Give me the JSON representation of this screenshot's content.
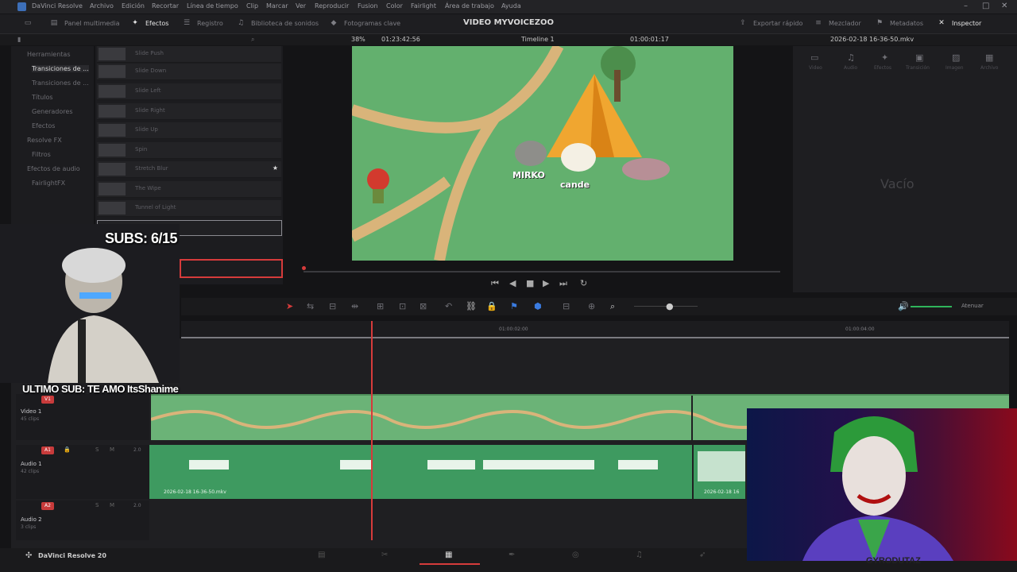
{
  "window": {
    "app_title": "DaVinci Resolve"
  },
  "menu": [
    "Archivo",
    "Edición",
    "Recortar",
    "Línea de tiempo",
    "Clip",
    "Marcar",
    "Ver",
    "Reproducir",
    "Fusion",
    "Color",
    "Fairlight",
    "Área de trabajo",
    "Ayuda"
  ],
  "toolbar": {
    "panel_multimedia": "Panel multimedia",
    "efectos": "Efectos",
    "registro": "Registro",
    "biblioteca": "Biblioteca de sonidos",
    "fotogramas": "Fotogramas clave",
    "project_title": "VIDEO MYVOICEZOO",
    "exportar": "Exportar rápido",
    "mezclador": "Mezclador",
    "metadatos": "Metadatos",
    "inspector": "Inspector"
  },
  "viewer_bar": {
    "zoom": "38%",
    "source_timecode": "01:23:42:56",
    "timeline_name": "Timeline 1",
    "record_timecode": "01:00:01:17",
    "clip_name": "2026-02-18 16-36-50.mkv"
  },
  "left_tree": {
    "herramientas": "Herramientas",
    "transiciones_video": "Transiciones de ...",
    "transiciones_audio": "Transiciones de ...",
    "titulos": "Títulos",
    "generadores": "Generadores",
    "efectos": "Efectos",
    "resolve_fx": "Resolve FX",
    "filtros": "Filtros",
    "efectos_audio": "Efectos de audio",
    "fairlight_fx": "FairlightFX"
  },
  "fx_items": [
    "Slide Push",
    "Slide Down",
    "Slide Left",
    "Slide Right",
    "Slide Up",
    "Spin",
    "Stretch Blur",
    "The Wipe",
    "Tunnel of Light"
  ],
  "inspector": {
    "tabs": [
      "Video",
      "Audio",
      "Efectos",
      "Transición",
      "Imagen",
      "Archivo"
    ],
    "empty": "Vacío"
  },
  "viewer_scene": {
    "name_left": "MIRKO",
    "name_right": "cande"
  },
  "timeline": {
    "tc_a": "01:00:02:00",
    "tc_b": "01:00:04:00",
    "atenuar": "Atenuar",
    "v1_badge": "V1",
    "v1_label": "Video 1",
    "v1_sub": "45 clips",
    "a1_badge": "A1",
    "a1_label": "Audio 1",
    "a1_sub": "42 clips",
    "a1_level": "2.0",
    "a2_badge": "A2",
    "a2_label": "Audio 2",
    "a2_sub": "3 clips",
    "a2_level": "2.0",
    "clip_name": "2026-02-18 16-36-50.mkv",
    "clip_name_short": "2026-02-18 16"
  },
  "bottom": {
    "brand": "DaVinci Resolve 20"
  },
  "overlay": {
    "subs": "SUBS: 6/15",
    "ultimo": "ULTIMO SUB: TE AMO ItsShanime",
    "corner_text": "GYRODUTAZ"
  },
  "colors": {
    "accent": "#d63b3b",
    "clip_video": "#6bb377",
    "clip_audio": "#3e9a60",
    "viewer_bg": "#63b06e"
  }
}
